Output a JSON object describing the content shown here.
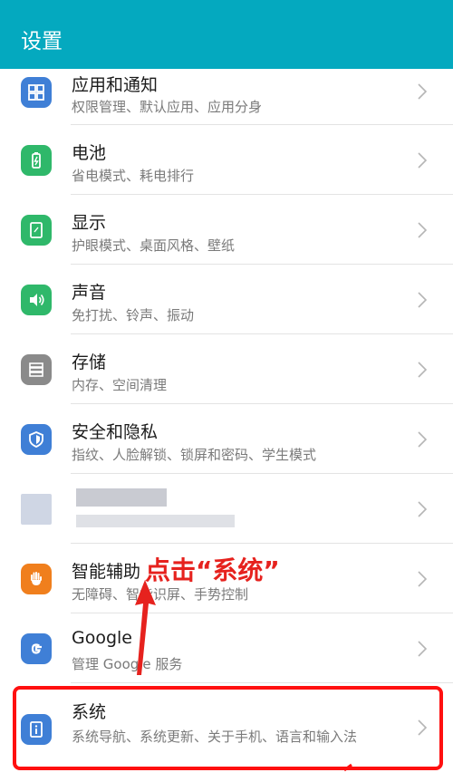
{
  "header": {
    "title": "设置"
  },
  "colors": {
    "header_bg": "#04a9bf",
    "annotation": "#e6221e"
  },
  "items": [
    {
      "title": "应用和通知",
      "subtitle": "权限管理、默认应用、应用分身",
      "icon": "apps-grid-icon",
      "color": "#3f7fd6"
    },
    {
      "title": "电池",
      "subtitle": "省电模式、耗电排行",
      "icon": "battery-icon",
      "color": "#2fb86a"
    },
    {
      "title": "显示",
      "subtitle": "护眼模式、桌面风格、壁纸",
      "icon": "display-icon",
      "color": "#2fb86a"
    },
    {
      "title": "声音",
      "subtitle": "免打扰、铃声、振动",
      "icon": "speaker-icon",
      "color": "#2fb86a"
    },
    {
      "title": "存储",
      "subtitle": "内存、空间清理",
      "icon": "storage-icon",
      "color": "#8a8a8a"
    },
    {
      "title": "安全和隐私",
      "subtitle": "指纹、人脸解锁、锁屏和密码、学生模式",
      "icon": "shield-icon",
      "color": "#3f7fd6"
    },
    {
      "title": "",
      "subtitle": "",
      "icon": "blurred-icon",
      "color": "#cfd6e4"
    },
    {
      "title": "智能辅助",
      "subtitle": "无障碍、智能识屏、手势控制",
      "icon": "hand-icon",
      "color": "#f07f1d"
    },
    {
      "title": "Google",
      "subtitle": "管理 Google 服务",
      "icon": "google-icon",
      "color": "#3f7fd6"
    },
    {
      "title": "系统",
      "subtitle": "系统导航、系统更新、关于手机、语言和输入法",
      "icon": "system-info-icon",
      "color": "#3f7fd6"
    }
  ],
  "annotation": {
    "text": "点击“系统”"
  }
}
